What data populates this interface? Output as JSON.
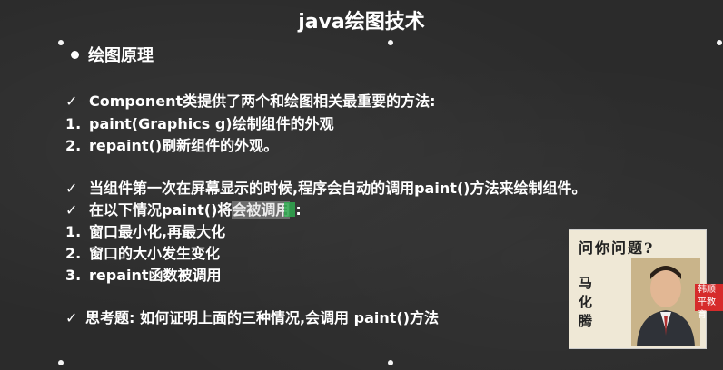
{
  "title": "java绘图技术",
  "heading": "绘图原理",
  "lines": [
    {
      "mark": "✓",
      "text": "Component类提供了两个和绘图相关最重要的方法:"
    },
    {
      "mark": "1.",
      "text": "paint(Graphics g)绘制组件的外观"
    },
    {
      "mark": "2.",
      "text": "repaint()刷新组件的外观。"
    },
    {
      "mark": "✓",
      "text": "当组件第一次在屏幕显示的时候,程序会自动的调用paint()方法来绘制组件。"
    },
    {
      "mark": "✓",
      "text_before": "在以下情况paint()将",
      "text_highlight": "会被调用",
      "text_after": ":"
    },
    {
      "mark": "1.",
      "text": "窗口最小化,再最大化"
    },
    {
      "mark": "2.",
      "text": "窗口的大小发生变化"
    },
    {
      "mark": "3.",
      "text": "repaint函数被调用"
    },
    {
      "mark": "✓",
      "text": "思考题: 如何证明上面的三种情况,会调用 paint()方法"
    }
  ],
  "video": {
    "question": "问你问题?",
    "name": "马化腾",
    "badge": "韩顺平教育"
  }
}
